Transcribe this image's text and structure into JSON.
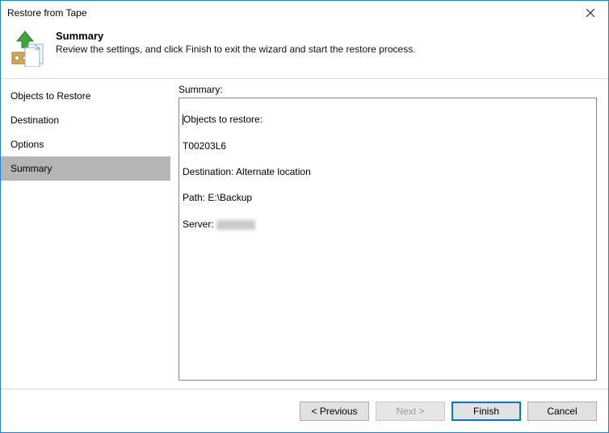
{
  "window": {
    "title": "Restore from Tape"
  },
  "header": {
    "title": "Summary",
    "description": "Review the settings, and click Finish to exit the wizard and start the restore process."
  },
  "sidebar": {
    "items": [
      {
        "label": "Objects to Restore",
        "selected": false
      },
      {
        "label": "Destination",
        "selected": false
      },
      {
        "label": "Options",
        "selected": false
      },
      {
        "label": "Summary",
        "selected": true
      }
    ]
  },
  "main": {
    "label": "Summary:",
    "lines": {
      "l0": "Objects to restore:",
      "l1": "T00203L6",
      "l2": "Destination: Alternate location",
      "l3": "Path: E:\\Backup",
      "l4_prefix": "Server: "
    }
  },
  "footer": {
    "previous": "<  Previous",
    "next": "Next  >",
    "finish": "Finish",
    "cancel": "Cancel"
  }
}
